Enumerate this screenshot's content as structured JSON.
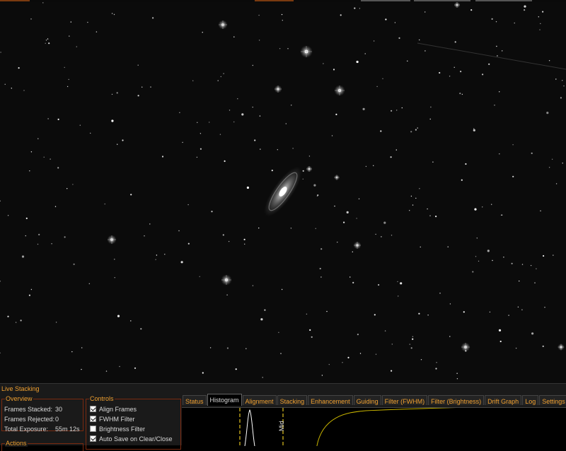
{
  "panel": {
    "title": "Live Stacking",
    "overview": {
      "label": "Overview",
      "rows": [
        {
          "label": "Frames Stacked:",
          "value": "30"
        },
        {
          "label": "Frames Rejected:",
          "value": "0"
        },
        {
          "label": "Total Exposure:",
          "value": "55m 12s"
        }
      ]
    },
    "actions": {
      "label": "Actions"
    },
    "controls": {
      "label": "Controls",
      "items": [
        {
          "label": "Align Frames",
          "checked": true
        },
        {
          "label": "FWHM Filter",
          "checked": true
        },
        {
          "label": "Brightness Filter",
          "checked": false
        },
        {
          "label": "Auto Save on Clear/Close",
          "checked": true
        }
      ]
    },
    "tabs": [
      "Status",
      "Histogram",
      "Alignment",
      "Stacking",
      "Enhancement",
      "Guiding",
      "Filter (FWHM)",
      "Filter (Brightness)",
      "Drift Graph",
      "Log",
      "Settings"
    ],
    "active_tab": "Histogram",
    "histogram": {
      "marker_label": "Mid"
    }
  },
  "colors": {
    "accent": "#f0a030",
    "border": "#7a2a10",
    "curve": "#c8b400",
    "marker": "#e0c020"
  }
}
